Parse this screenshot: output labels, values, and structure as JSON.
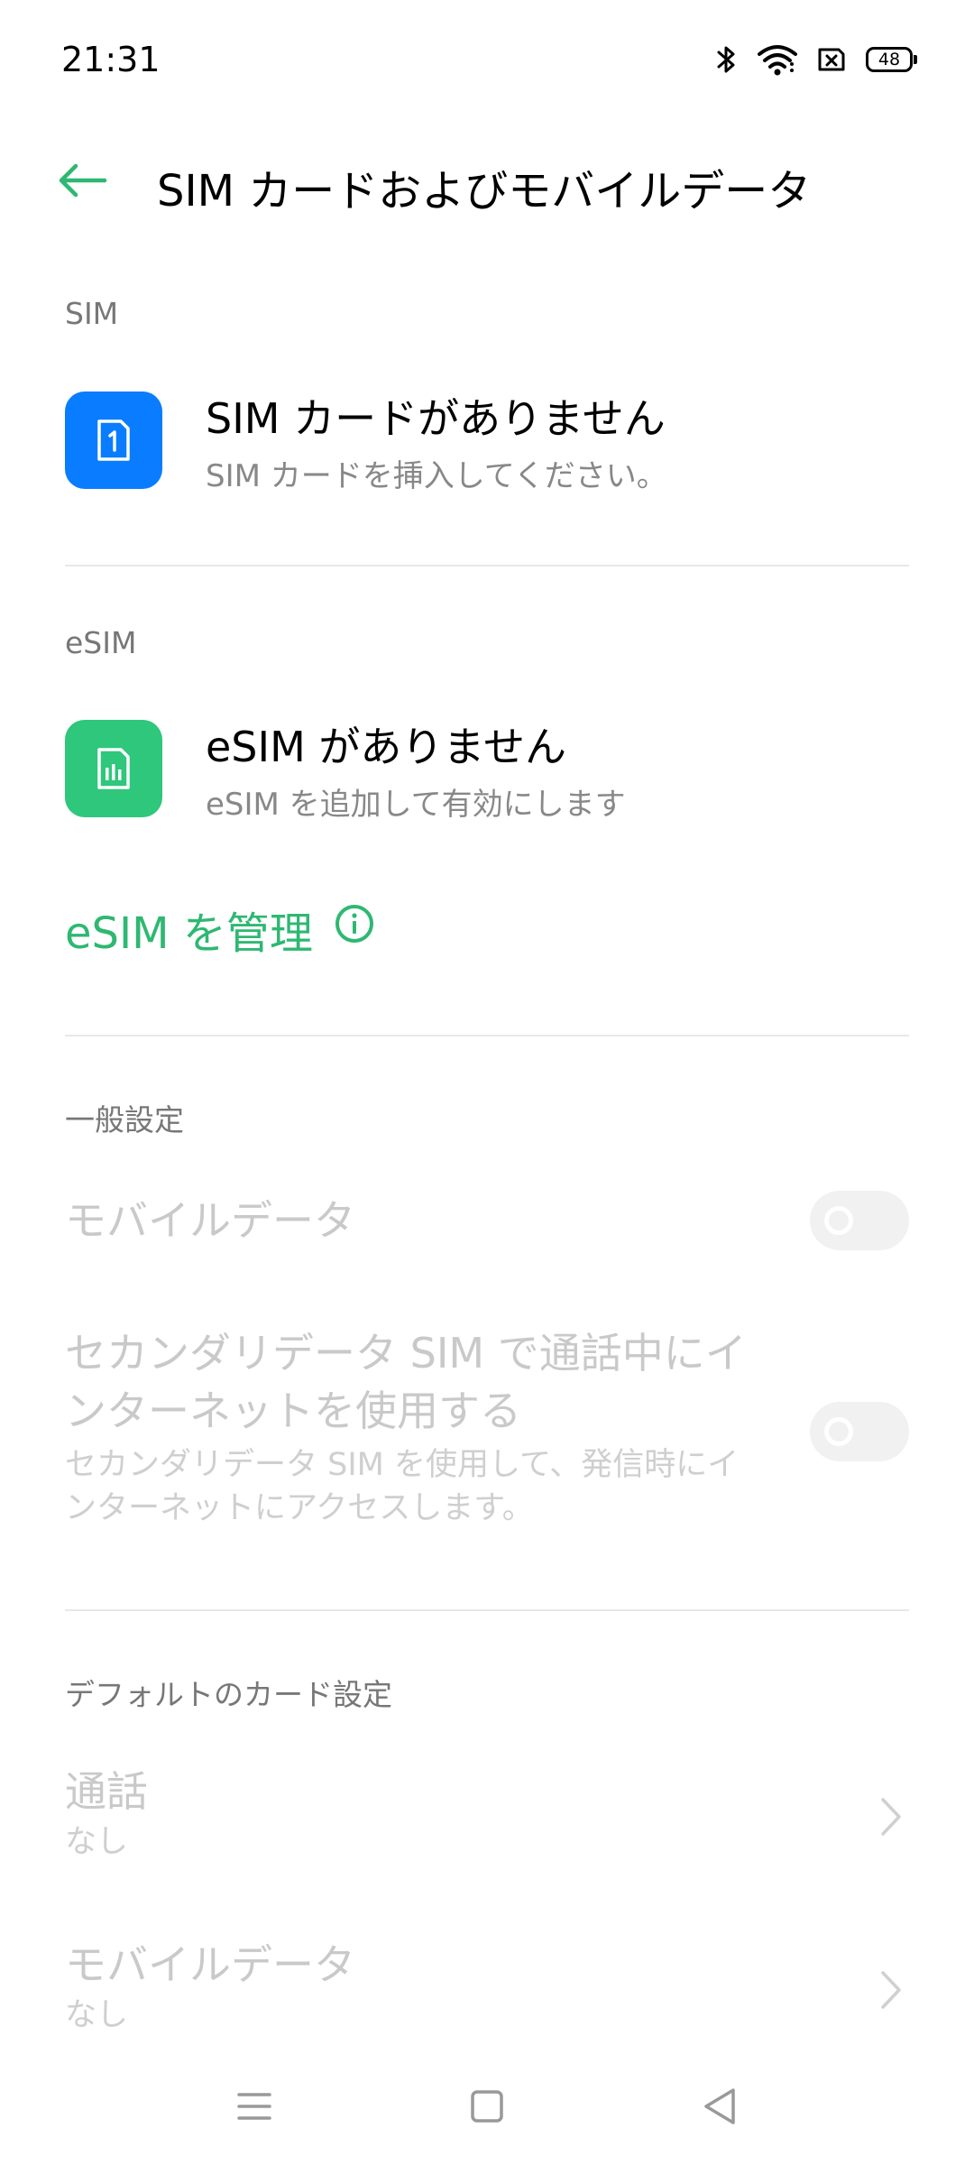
{
  "status_bar": {
    "time": "21:31",
    "battery": "48",
    "icons": [
      "bluetooth-icon",
      "wifi-icon",
      "no-sim-icon",
      "battery-icon"
    ]
  },
  "header": {
    "title": "SIM カードおよびモバイルデータ",
    "back_icon": "back-arrow-icon"
  },
  "sim_section": {
    "label": "SIM",
    "card_title": "SIM カードがありません",
    "card_subtitle": "SIM カードを挿入してください。",
    "icon_color": "#0a7cff"
  },
  "esim_section": {
    "label": "eSIM",
    "card_title": "eSIM がありません",
    "card_subtitle": "eSIM を追加して有効にします",
    "icon_color": "#2ec77c",
    "manage_label": "eSIM を管理"
  },
  "general_section": {
    "label": "一般設定",
    "mobile_data": {
      "title": "モバイルデータ",
      "enabled": false
    },
    "secondary_data": {
      "title_line1": "セカンダリデータ SIM で通話中にイ",
      "title_line2": "ンターネットを使用する",
      "desc_line1": "セカンダリデータ SIM を使用して、発信時にイ",
      "desc_line2": "ンターネットにアクセスします。",
      "enabled": false
    }
  },
  "default_card_section": {
    "label": "デフォルトのカード設定",
    "items": [
      {
        "title": "通話",
        "value": "なし"
      },
      {
        "title": "モバイルデータ",
        "value": "なし"
      }
    ]
  },
  "colors": {
    "accent": "#2eb872",
    "sim_blue": "#0a7cff",
    "esim_green": "#2ec77c",
    "disabled_text": "#c9c9c9"
  },
  "nav_bar": {
    "items": [
      "menu-icon",
      "home-icon",
      "back-icon"
    ]
  }
}
